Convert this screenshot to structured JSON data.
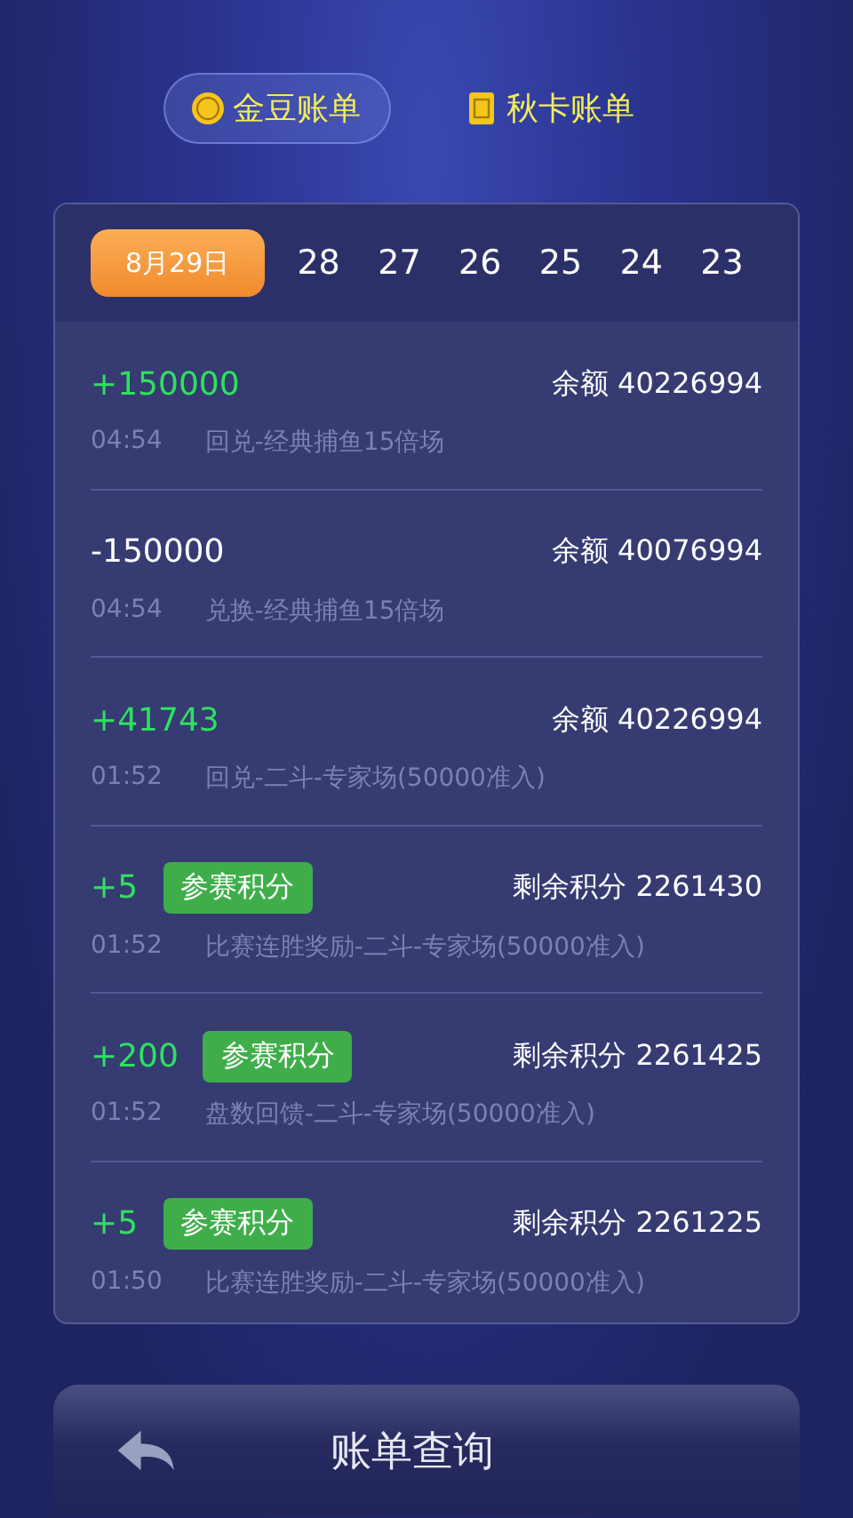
{
  "tabs": [
    {
      "label": "金豆账单",
      "selected": true
    },
    {
      "label": "秋卡账单",
      "selected": false
    }
  ],
  "dates": [
    {
      "label": "8月29日",
      "selected": true
    },
    {
      "label": "28",
      "selected": false
    },
    {
      "label": "27",
      "selected": false
    },
    {
      "label": "26",
      "selected": false
    },
    {
      "label": "25",
      "selected": false
    },
    {
      "label": "24",
      "selected": false
    },
    {
      "label": "23",
      "selected": false
    }
  ],
  "records": [
    {
      "amount": "+150000",
      "positive": true,
      "balance": "余额 40226994",
      "time": "04:54",
      "description": "回兑-经典捕鱼15倍场"
    },
    {
      "amount": "-150000",
      "positive": false,
      "balance": "余额 40076994",
      "time": "04:54",
      "description": "兑换-经典捕鱼15倍场"
    },
    {
      "amount": "+41743",
      "positive": true,
      "balance": "余额 40226994",
      "time": "01:52",
      "description": "回兑-二斗-专家场(50000准入)"
    },
    {
      "amount": "+5",
      "positive": true,
      "badge": "参赛积分",
      "balance": "剩余积分 2261430",
      "time": "01:52",
      "description": "比赛连胜奖励-二斗-专家场(50000准入)"
    },
    {
      "amount": "+200",
      "positive": true,
      "badge": "参赛积分",
      "balance": "剩余积分 2261425",
      "time": "01:52",
      "description": "盘数回馈-二斗-专家场(50000准入)"
    },
    {
      "amount": "+5",
      "positive": true,
      "badge": "参赛积分",
      "balance": "剩余积分 2261225",
      "time": "01:50",
      "description": "比赛连胜奖励-二斗-专家场(50000准入)"
    }
  ],
  "footer": {
    "title": "账单查询"
  }
}
